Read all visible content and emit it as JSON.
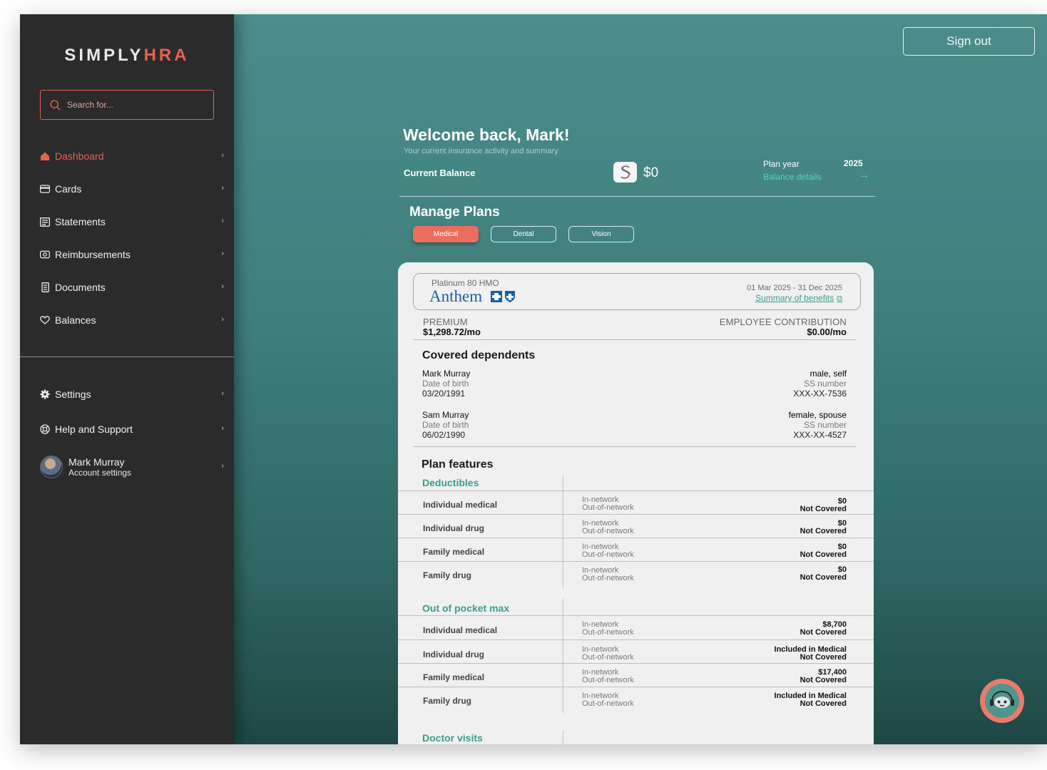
{
  "app": {
    "logo_part1": "SIMPLY",
    "logo_part2": "HRA",
    "brand_color": "#e8604f",
    "accent_color": "#3b9e8c"
  },
  "sidebar": {
    "search_placeholder": "Search for...",
    "items": [
      {
        "label": "Dashboard",
        "icon": "home-icon",
        "active": true
      },
      {
        "label": "Cards",
        "icon": "card-icon"
      },
      {
        "label": "Statements",
        "icon": "statement-icon"
      },
      {
        "label": "Reimbursements",
        "icon": "reimbursement-icon"
      },
      {
        "label": "Documents",
        "icon": "document-icon"
      },
      {
        "label": "Balances",
        "icon": "heart-icon"
      }
    ],
    "bottom_items": [
      {
        "label": "Settings",
        "icon": "gear-icon"
      },
      {
        "label": "Help and Support",
        "icon": "lifebuoy-icon"
      }
    ],
    "user": {
      "name": "Mark Murray",
      "subtitle": "Account settings"
    }
  },
  "header": {
    "signout_label": "Sign out",
    "welcome": "Welcome back, Mark!",
    "welcome_sub": "Your current insurance activity and summary",
    "current_balance_label": "Current Balance",
    "balance_amount": "$0",
    "plan_year_label": "Plan year",
    "plan_year_value": "2025",
    "balance_details_label": "Balance details"
  },
  "plans": {
    "title": "Manage Plans",
    "tabs": [
      {
        "label": "Medical",
        "active": true
      },
      {
        "label": "Dental"
      },
      {
        "label": "Vision"
      }
    ]
  },
  "plan_card": {
    "plan_name": "Platinum 80 HMO",
    "insurer": "Anthem",
    "dates": "01 Mar 2025 - 31 Dec 2025",
    "summary_link": "Summary of benefits",
    "premium_label": "PREMIUM",
    "premium_value": "$1,298.72/mo",
    "contribution_label": "EMPLOYEE CONTRIBUTION",
    "contribution_value": "$0.00/mo",
    "dependents_title": "Covered dependents",
    "dependents": [
      {
        "name": "Mark Murray",
        "dob_label": "Date of birth",
        "dob": "03/20/1991",
        "relation": "male, self",
        "ss_label": "SS number",
        "ss": "XXX-XX-7536"
      },
      {
        "name": "Sam Murray",
        "dob_label": "Date of birth",
        "dob": "06/02/1990",
        "relation": "female, spouse",
        "ss_label": "SS number",
        "ss": "XXX-XX-4527"
      }
    ],
    "features_title": "Plan features",
    "net_in": "In-network",
    "net_out": "Out-of-network",
    "groups": [
      {
        "title": "Deductibles",
        "rows": [
          {
            "label": "Individual medical",
            "in": "$0",
            "out": "Not Covered"
          },
          {
            "label": "Individual drug",
            "in": "$0",
            "out": "Not Covered"
          },
          {
            "label": "Family medical",
            "in": "$0",
            "out": "Not Covered"
          },
          {
            "label": "Family drug",
            "in": "$0",
            "out": "Not Covered"
          }
        ]
      },
      {
        "title": "Out of pocket max",
        "rows": [
          {
            "label": "Individual medical",
            "in": "$8,700",
            "out": "Not Covered"
          },
          {
            "label": "Individual drug",
            "in": "Included in Medical",
            "out": "Not Covered"
          },
          {
            "label": "Family medical",
            "in": "$17,400",
            "out": "Not Covered"
          },
          {
            "label": "Family drug",
            "in": "Included in Medical",
            "out": "Not Covered"
          }
        ]
      },
      {
        "title": "Doctor visits",
        "rows": []
      }
    ]
  }
}
